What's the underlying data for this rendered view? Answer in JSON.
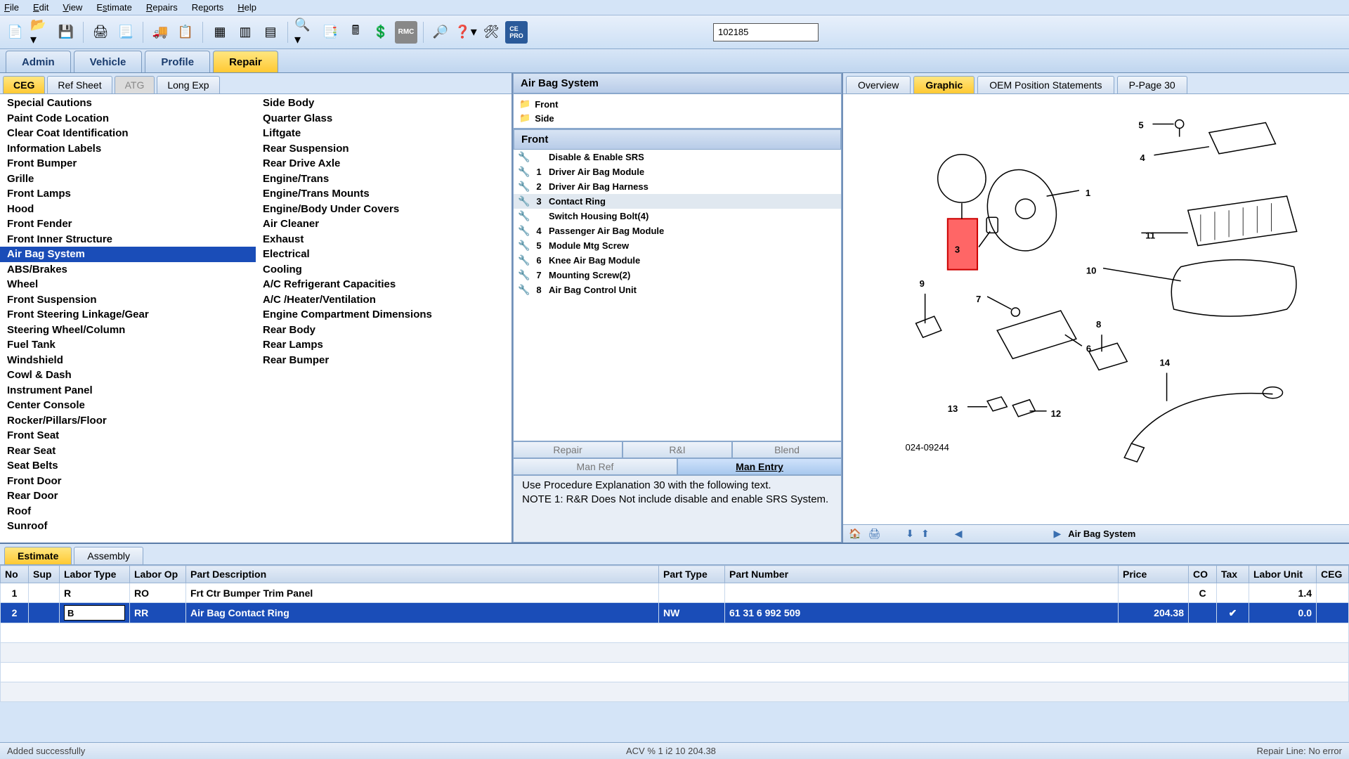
{
  "menu": {
    "file": "File",
    "edit": "Edit",
    "view": "View",
    "estimate": "Estimate",
    "repairs": "Repairs",
    "reports": "Reports",
    "help": "Help"
  },
  "toolbar": {
    "search_value": "102185"
  },
  "maintabs": {
    "admin": "Admin",
    "vehicle": "Vehicle",
    "profile": "Profile",
    "repair": "Repair"
  },
  "subtabs": {
    "ceg": "CEG",
    "refsheet": "Ref Sheet",
    "atg": "ATG",
    "longexp": "Long Exp"
  },
  "categories_col1": [
    "Special Cautions",
    "Paint Code Location",
    "Clear Coat Identification",
    "Information Labels",
    "Front Bumper",
    "Grille",
    "Front Lamps",
    "Hood",
    "Front Fender",
    "Front Inner Structure",
    "Air Bag System",
    "ABS/Brakes",
    "Wheel",
    "Front Suspension",
    "Front Steering Linkage/Gear",
    "Steering Wheel/Column",
    "Fuel Tank",
    "Windshield",
    "Cowl & Dash",
    "Instrument Panel",
    "Center Console",
    "Rocker/Pillars/Floor",
    "Front Seat",
    "Rear Seat",
    "Seat Belts",
    "Front Door",
    "Rear Door",
    "Roof",
    "Sunroof"
  ],
  "categories_selected": 10,
  "categories_col2": [
    "Side Body",
    "Quarter Glass",
    "Liftgate",
    "Rear Suspension",
    "Rear Drive Axle",
    "Engine/Trans",
    "Engine/Trans Mounts",
    "Engine/Body Under Covers",
    "Air Cleaner",
    "Exhaust",
    "Electrical",
    "Cooling",
    "A/C Refrigerant Capacities",
    "A/C /Heater/Ventilation",
    "Engine Compartment Dimensions",
    "Rear Body",
    "Rear Lamps",
    "Rear Bumper"
  ],
  "mid": {
    "title": "Air Bag System",
    "tree": [
      "Front",
      "Side"
    ],
    "list_title": "Front",
    "parts": [
      {
        "num": "",
        "label": "Disable & Enable SRS"
      },
      {
        "num": "1",
        "label": "Driver Air Bag Module"
      },
      {
        "num": "2",
        "label": "Driver Air Bag Harness"
      },
      {
        "num": "3",
        "label": "Contact Ring",
        "selected": true
      },
      {
        "num": "",
        "label": "Switch Housing Bolt(4)"
      },
      {
        "num": "4",
        "label": "Passenger Air Bag Module"
      },
      {
        "num": "5",
        "label": "Module Mtg Screw"
      },
      {
        "num": "6",
        "label": "Knee Air Bag Module"
      },
      {
        "num": "7",
        "label": "Mounting Screw(2)"
      },
      {
        "num": "8",
        "label": "Air Bag Control Unit"
      }
    ],
    "buttons": {
      "repair": "Repair",
      "ri": "R&I",
      "blend": "Blend",
      "manref": "Man Ref",
      "manentry": "Man Entry"
    },
    "notes": " Use Procedure Explanation 30 with the following text.\n NOTE 1: R&R Does Not include disable and enable SRS System."
  },
  "righttabs": {
    "overview": "Overview",
    "graphic": "Graphic",
    "oem": "OEM Position Statements",
    "ppage": "P-Page 30"
  },
  "diagram": {
    "ref": "024-09244",
    "breadcrumb": "Air Bag System",
    "highlight": "3"
  },
  "bottomtabs": {
    "estimate": "Estimate",
    "assembly": "Assembly"
  },
  "grid": {
    "headers": {
      "no": "No",
      "sup": "Sup",
      "lt": "Labor Type",
      "lo": "Labor Op",
      "desc": "Part Description",
      "pt": "Part Type",
      "pn": "Part Number",
      "price": "Price",
      "co": "CO",
      "tax": "Tax",
      "lu": "Labor Unit",
      "ceg": "CEG"
    },
    "rows": [
      {
        "no": "1",
        "sup": "",
        "lt": "R",
        "lo": "RO",
        "desc": "Frt Ctr Bumper Trim Panel",
        "pt": "",
        "pn": "",
        "price": "",
        "co": "C",
        "tax": "",
        "lu": "1.4",
        "ceg": ""
      },
      {
        "no": "2",
        "sup": "",
        "lt": "B",
        "lo": "RR",
        "desc": "Air Bag Contact Ring",
        "pt": "NW",
        "pn": "61 31 6 992 509",
        "price": "204.38",
        "co": "",
        "tax": "✔",
        "lu": "0.0",
        "ceg": "",
        "selected": true
      }
    ]
  },
  "status": {
    "left": "Added successfully",
    "mid": "ACV % 1    i2         10    204.38",
    "right": "Repair Line: No error"
  }
}
